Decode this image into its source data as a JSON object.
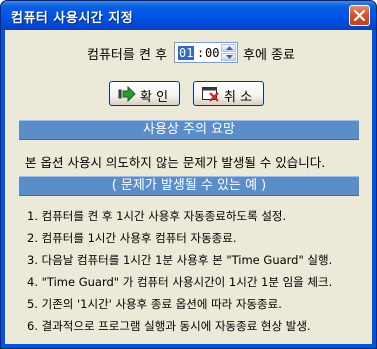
{
  "window": {
    "title": "컴퓨터 사용시간 지정"
  },
  "timer": {
    "prefix": "컴퓨터를 켠 후",
    "hours": "01",
    "separator": ":",
    "minutes": "00",
    "suffix": "후에 종료"
  },
  "buttons": {
    "ok": "확 인",
    "cancel": "취 소"
  },
  "section1": {
    "header": "사용상 주의 요망",
    "text": "본 옵션 사용시 의도하지 않는 문제가 발생될 수 있습니다."
  },
  "section2": {
    "header": "( 문제가 발생될 수 있는 예 )",
    "items": [
      "1. 컴퓨터를 켠 후 1시간 사용후 자동종료하도록 설정.",
      "2. 컴퓨터를 1시간 사용후 컴퓨터 자동종료.",
      "3. 다음날 컴퓨터를 1시간 1분 사용후 본 \"Time Guard\" 실행.",
      "4. \"Time Guard\" 가 컴퓨터 사용시간이 1시간 1분 임을 체크.",
      "5. 기존의 '1시간' 사용후 종료 옵션에 따라 자동종료.",
      "6. 결과적으로 프로그램 실행과 동시에 자동종료 현상 발생."
    ]
  },
  "colors": {
    "titlebar": "#0055e5",
    "banner": "#5b8ec9",
    "client": "#ece9d8",
    "selection": "#316ac5"
  },
  "icons": {
    "close": "close-icon",
    "ok": "arrow-right-icon",
    "cancel": "cancel-icon",
    "spin_up": "spin-up-icon",
    "spin_down": "spin-down-icon"
  }
}
